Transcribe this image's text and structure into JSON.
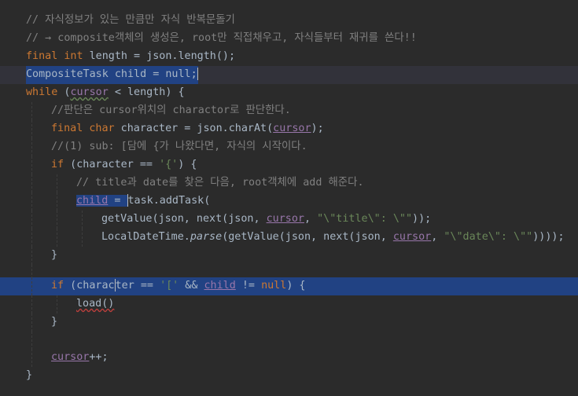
{
  "editor": {
    "lines": [
      {
        "text": "// 자식정보가 있는 만큼만 자식 반복문돌기"
      },
      {
        "text": "// → composite객체의 생성은, root만 직접채우고, 자식들부터 재귀를 쓴다!!"
      },
      {
        "kw1": "final",
        "kw2": "int",
        "rest": " length = json.length();"
      },
      {
        "text": "CompositeTask child = null;"
      },
      {
        "kw": "while",
        "rest1": " (",
        "var": "cursor",
        "rest2": " < length) {"
      },
      {
        "text": "//판단은 cursor위치의 charactor로 판단한다."
      },
      {
        "kw1": "final",
        "kw2": "char",
        "rest1": " character = json.charAt(",
        "var": "cursor",
        "rest2": ");"
      },
      {
        "text": "//(1) sub: [담에 {가 나왔다면, 자식의 시작이다."
      },
      {
        "kw": "if",
        "rest": " (character == ",
        "str": "'{'",
        "end": ") {"
      },
      {
        "text": "// title과 date를 찾은 다음, root객체에 add 해준다."
      },
      {
        "var": "child",
        "mid": " = ",
        "rest": "task.addTask("
      },
      {
        "a": "getValue(json, next(json, ",
        "var": "cursor",
        "b": ", ",
        "str": "\"\\\"title\\\": \\\"\"",
        "c": "));"
      },
      {
        "a": "LocalDateTime.",
        "it": "parse",
        "b": "(getValue(json, next(json, ",
        "var": "cursor",
        "c": ", ",
        "str": "\"\\\"date\\\": \\\"\"",
        "d": "))));"
      },
      {
        "text": "}"
      },
      {
        "text": ""
      },
      {
        "kw": "if",
        "a": " (charac",
        "b": "ter == ",
        "str": "'['",
        "c": " && ",
        "var": "child",
        "d": " != ",
        "kw2": "null",
        "e": ") {"
      },
      {
        "text": "load()"
      },
      {
        "text": "}"
      },
      {
        "text": ""
      },
      {
        "var": "cursor",
        "rest": "++;"
      },
      {
        "text": "}"
      }
    ]
  },
  "colors": {
    "background": "#2b2b2b",
    "keyword": "#cc7832",
    "comment": "#808080",
    "string": "#6a8759",
    "field": "#9876aa",
    "selection": "#214283",
    "text": "#a9b7c6"
  }
}
